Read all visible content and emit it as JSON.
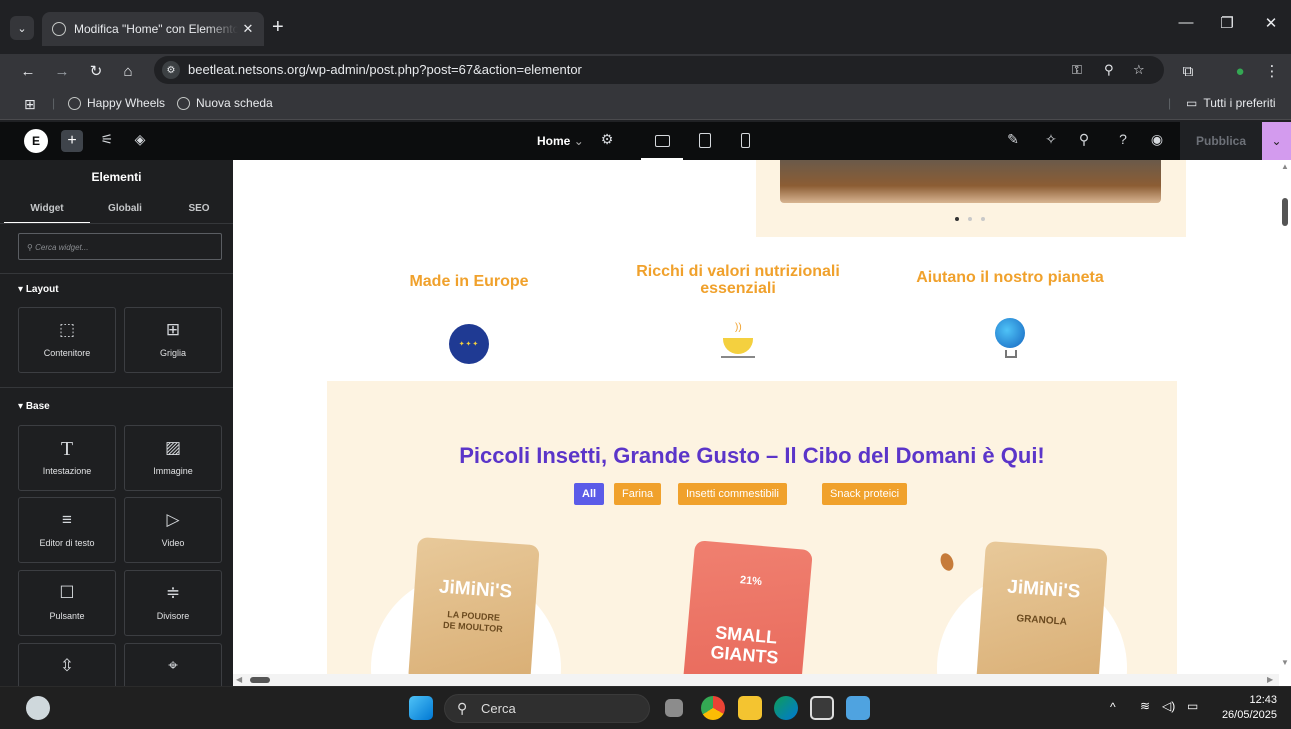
{
  "browser": {
    "tab_title": "Modifica \"Home\" con Elementor",
    "tab_close": "✕",
    "new_tab": "+",
    "url": "beetleat.netsons.org/wp-admin/post.php?post=67&action=elementor",
    "bookmarks": [
      "Happy Wheels",
      "Nuova scheda"
    ],
    "all_bookmarks": "Tutti i preferiti"
  },
  "editor": {
    "page_name": "Home",
    "publish_label": "Pubblica"
  },
  "panel": {
    "title": "Elementi",
    "tabs": [
      "Widget",
      "Globali",
      "SEO"
    ],
    "search_placeholder": "Cerca widget...",
    "sections": [
      {
        "title": "Layout",
        "widgets": [
          {
            "label": "Contenitore",
            "icon": "container-icon"
          },
          {
            "label": "Griglia",
            "icon": "grid-icon"
          }
        ]
      },
      {
        "title": "Base",
        "widgets": [
          {
            "label": "Intestazione",
            "icon": "heading-icon"
          },
          {
            "label": "Immagine",
            "icon": "image-icon"
          },
          {
            "label": "Editor di testo",
            "icon": "text-editor-icon"
          },
          {
            "label": "Video",
            "icon": "video-icon"
          },
          {
            "label": "Pulsante",
            "icon": "button-icon"
          },
          {
            "label": "Divisore",
            "icon": "divider-icon"
          }
        ]
      }
    ]
  },
  "page": {
    "features": [
      {
        "title": "Made in Europe",
        "icon": "eu-flag-icon"
      },
      {
        "title": "Ricchi di valori nutrizionali essenziali",
        "icon": "bowl-icon"
      },
      {
        "title": "Aiutano il nostro pianeta",
        "icon": "globe-icon"
      }
    ],
    "headline": "Piccoli Insetti, Grande Gusto – Il Cibo del Domani è Qui!",
    "filters": [
      "All",
      "Farina",
      "Insetti commestibili",
      "Snack proteici"
    ],
    "active_filter": "All",
    "products": [
      {
        "brand": "JiMiNi'S",
        "line1": "LA POUDRE",
        "line2": "DE MOULTOR"
      },
      {
        "brand": "SMALL",
        "line1": "GIANTS",
        "line2": "21%"
      },
      {
        "brand": "JiMiNi'S",
        "line1": "GRANOLA",
        "line2": ""
      }
    ]
  },
  "taskbar": {
    "search_label": "Cerca",
    "time": "12:43",
    "date": "26/05/2025"
  },
  "colors": {
    "accent_orange": "#f0a12c",
    "headline_purple": "#5b35c9",
    "filter_active": "#5b5be8",
    "section_bg": "#fdf3e1",
    "publish_accent": "#d39bee"
  }
}
